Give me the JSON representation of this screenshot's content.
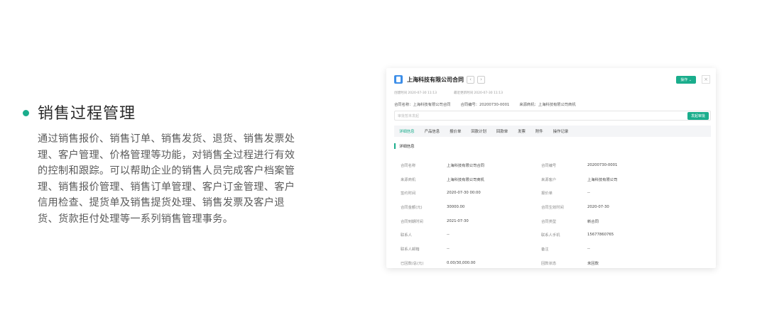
{
  "feature": {
    "title": "销售过程管理",
    "description": "通过销售报价、销售订单、销售发货、退货、销售发票处理、客户管理、价格管理等功能，对销售全过程进行有效的控制和跟踪。可以帮助企业的销售人员完成客户档案管理、销售报价管理、销售订单管理、客户订金管理、客户信用检查、提货单及销售提货处理、销售发票及客户退货、货款拒付处理等一系列销售管理事务。",
    "accent_color": "#1aad8c"
  },
  "card": {
    "title": "上海科技有限公司合同",
    "operate_label": "操作 ⌄",
    "meta": {
      "created": "创建时间 2020-07-30 11:13",
      "updated": "最近更新时间 2020-07-30 11:13"
    },
    "info": {
      "contract_name": "合同名称：上海科技有限公司合同",
      "contract_no": "合同编号：20200730-0001",
      "source_opportunity": "来源商机：上海科技有限公司商机"
    },
    "approval": {
      "placeholder": "审批暂未发起",
      "button": "发起审批"
    },
    "tabs": [
      "详细信息",
      "产品信息",
      "报价单",
      "回款计划",
      "回款单",
      "发票",
      "附件",
      "操作记录"
    ],
    "section_title": "详细信息",
    "fields": [
      {
        "l1": "合同名称",
        "v1": "上海科技有限公司合同",
        "l2": "合同编号",
        "v2": "20200730-0001"
      },
      {
        "l1": "来源商机",
        "v1": "上海科技有限公司商机",
        "l2": "来源客户",
        "v2": "上海科技有限公司"
      },
      {
        "l1": "签约时间",
        "v1": "2020-07-30 00:00",
        "l2": "报价单",
        "v2": "--"
      },
      {
        "l1": "合同金额(元)",
        "v1": "30000.00",
        "l2": "合同生效时间",
        "v2": "2020-07-30"
      },
      {
        "l1": "合同到期时间",
        "v1": "2021-07-30",
        "l2": "合同类型",
        "v2": "新合同"
      },
      {
        "l1": "联系人",
        "v1": "--",
        "l2": "联系人手机",
        "v2": "15677860765"
      },
      {
        "l1": "联系人邮箱",
        "v1": "--",
        "l2": "备注",
        "v2": "--"
      },
      {
        "l1": "已回款/总(元)",
        "v1": "0.00/30,000.00",
        "l2": "回款状态",
        "v2": "未回款"
      }
    ]
  }
}
